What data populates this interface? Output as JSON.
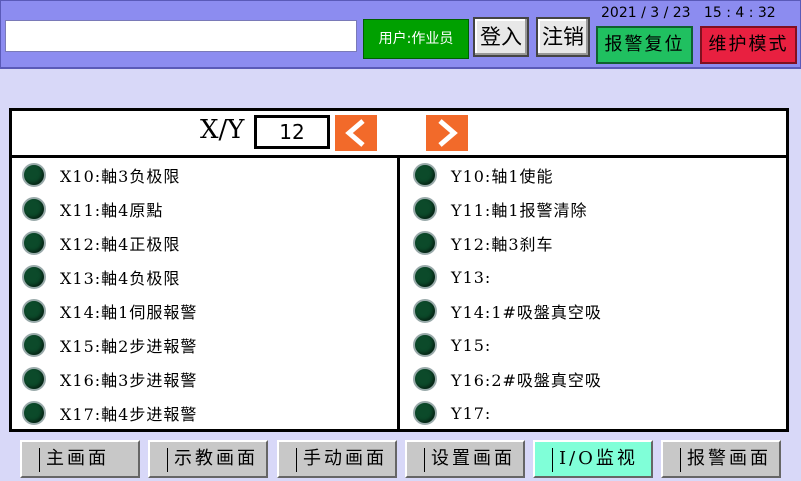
{
  "header": {
    "message": "",
    "user_label": "用户:作业员",
    "login_label": "登入",
    "logout_label": "注销",
    "datetime": "2021 / 3 / 23   15 : 4 : 32",
    "alarm_reset_label": "报警复位",
    "maintenance_label": "维护模式"
  },
  "xy": {
    "label": "X/Y",
    "value": "12",
    "prev_icon": "chevron-left-icon",
    "next_icon": "chevron-right-icon"
  },
  "inputs": [
    {
      "label": "X10:軸3负极限"
    },
    {
      "label": "X11:軸4原點"
    },
    {
      "label": "X12:軸4正极限"
    },
    {
      "label": "X13:軸4负极限"
    },
    {
      "label": "X14:軸1伺服報警"
    },
    {
      "label": "X15:軸2步进報警"
    },
    {
      "label": "X16:軸3步进報警"
    },
    {
      "label": "X17:軸4步进報警"
    }
  ],
  "outputs": [
    {
      "label": "Y10:轴1使能"
    },
    {
      "label": "Y11:軸1报警清除"
    },
    {
      "label": "Y12:軸3刹车"
    },
    {
      "label": "Y13:"
    },
    {
      "label": "Y14:1#吸盤真空吸"
    },
    {
      "label": "Y15:"
    },
    {
      "label": "Y16:2#吸盤真空吸"
    },
    {
      "label": "Y17:"
    }
  ],
  "nav": [
    {
      "label": "主画面",
      "active": false
    },
    {
      "label": "示教画面",
      "active": false
    },
    {
      "label": "手动画面",
      "active": false
    },
    {
      "label": "设置画面",
      "active": false
    },
    {
      "label": "I/O监视",
      "active": true
    },
    {
      "label": "报警画面",
      "active": false
    }
  ],
  "colors": {
    "header_bg": "#8c8cf0",
    "user_badge": "#00a000",
    "alarm_reset": "#20c060",
    "maintenance": "#e82040",
    "arrow": "#f26a2a",
    "lamp_off": "#0c4a2a",
    "nav_active": "#80ffd8"
  }
}
